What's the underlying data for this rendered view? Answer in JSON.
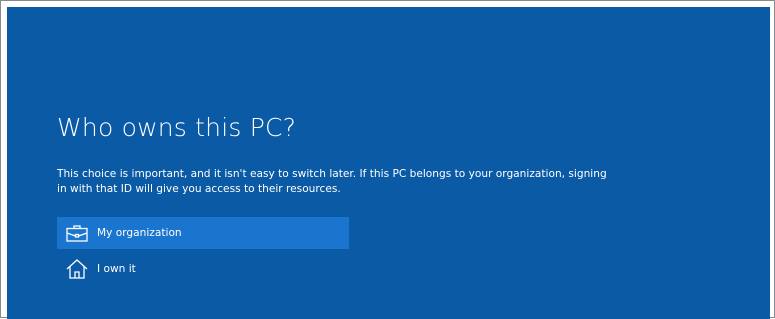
{
  "oobe": {
    "title": "Who owns this PC?",
    "description": "This choice is important, and it isn't easy to switch later. If this PC belongs to your organization, signing in with that ID will give you access to their resources.",
    "options": [
      {
        "label": "My organization",
        "icon": "briefcase-icon",
        "selected": true
      },
      {
        "label": "I own it",
        "icon": "home-icon",
        "selected": false
      }
    ]
  },
  "colors": {
    "background": "#0a5aa6",
    "selected_option": "#1a75cf",
    "text": "#ffffff"
  }
}
